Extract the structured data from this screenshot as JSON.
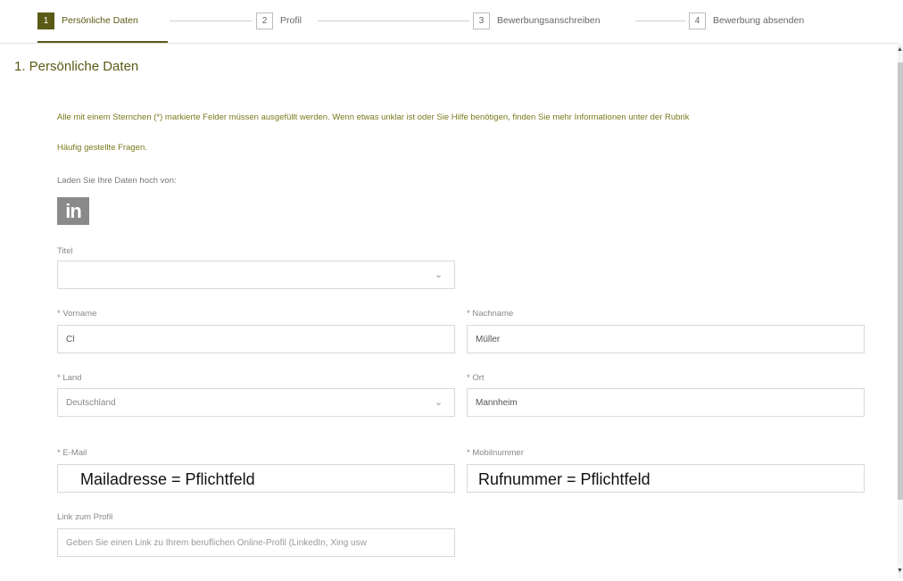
{
  "stepper": {
    "steps": [
      {
        "num": "1",
        "label": "Persönliche Daten"
      },
      {
        "num": "2",
        "label": "Profil"
      },
      {
        "num": "3",
        "label": "Bewerbungsanschreiben"
      },
      {
        "num": "4",
        "label": "Bewerbung absenden"
      }
    ],
    "active_step": 1
  },
  "section_title": "1. Persönliche Daten",
  "info": {
    "text": "Alle mit einem Sternchen (*) markierte Felder müssen ausgefüllt werden. Wenn etwas unklar ist oder Sie Hilfe benötigen, finden Sie mehr Informationen unter der Rubrik",
    "faq_link": "Häufig gestellte Fragen."
  },
  "upload": {
    "label": "Laden Sie Ihre Daten hoch von:",
    "linkedin_icon": "linkedin-icon"
  },
  "form": {
    "title_label": "Titel",
    "title_value": "",
    "firstname_label": "* Vorname",
    "firstname_value": "Cl",
    "lastname_label": "* Nachname",
    "lastname_value": "Müller",
    "country_label": "* Land",
    "country_value": "Deutschland",
    "city_label": "* Ort",
    "city_value": "Mannheim",
    "email_label": "* E-Mail",
    "email_overlay": "Mailadresse = Pflichtfeld",
    "mobile_label": "* Mobilnummer",
    "mobile_overlay": "Rufnummer = Pflichtfeld",
    "profile_link_label": "Link zum Profil",
    "profile_link_placeholder": "Geben Sie einen Link zu Ihrem beruflichen Online-Profil (LinkedIn, Xing usw"
  },
  "colors": {
    "accent": "#5b5a16",
    "info_text": "#7a7a1f"
  }
}
